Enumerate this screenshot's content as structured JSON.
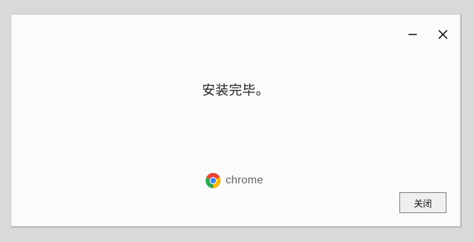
{
  "dialog": {
    "message": "安装完毕。",
    "brand_label": "chrome",
    "close_button_label": "关闭"
  },
  "window_controls": {
    "minimize_icon": "minimize-icon",
    "close_icon": "close-icon"
  },
  "colors": {
    "background": "#d9d9d9",
    "window": "#fbfbfb",
    "chrome_red": "#ea4335",
    "chrome_yellow": "#fbbc04",
    "chrome_green": "#34a853",
    "chrome_blue": "#4285f4"
  }
}
